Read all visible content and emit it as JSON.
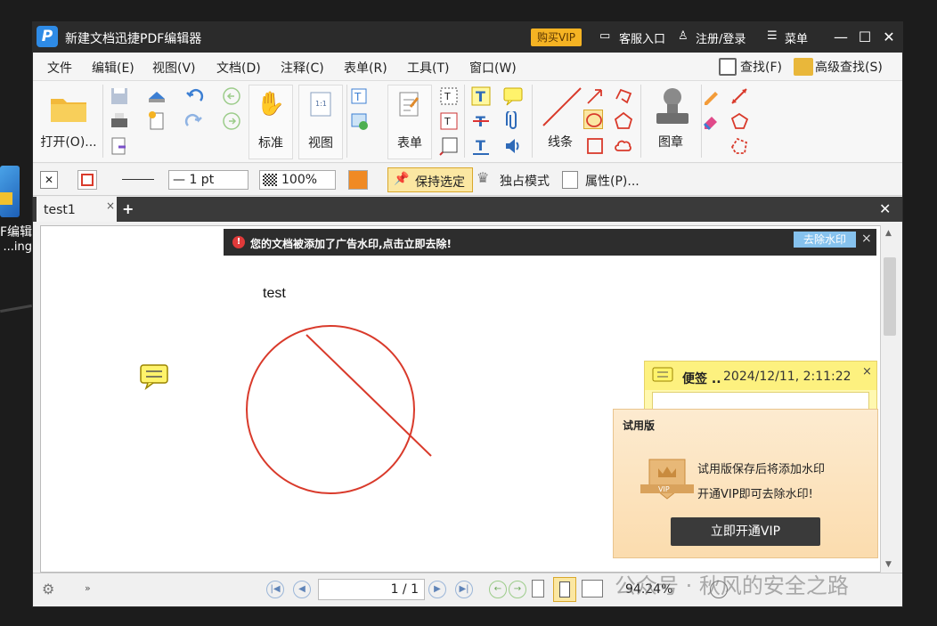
{
  "desktop": {
    "label1": "F编辑",
    "label2": "ing..."
  },
  "titlebar": {
    "logo": "P",
    "title": "新建文档迅捷PDF编辑器",
    "vip": "购买VIP",
    "service": "客服入口",
    "register": "注册/登录",
    "menu": "菜单"
  },
  "menubar": {
    "items": [
      "文件",
      "编辑(E)",
      "视图(V)",
      "文档(D)",
      "注释(C)",
      "表单(R)",
      "工具(T)",
      "窗口(W)"
    ],
    "find": "查找(F)",
    "adv_find": "高级查找(S)"
  },
  "ribbon": {
    "open": "打开(O)...",
    "standard": "标准",
    "view": "视图",
    "form": "表单",
    "line": "线条",
    "stamp": "图章"
  },
  "toolbar2": {
    "line_width": "— 1 pt",
    "opacity": "100%",
    "keep": "保持选定",
    "exclusive": "独占模式",
    "props": "属性(P)..."
  },
  "tabs": {
    "tab1": "test1",
    "close": "×",
    "add": "+"
  },
  "notice": {
    "text": "您的文档被添加了广告水印,点击立即去除!",
    "button": "去除水印",
    "close": "×"
  },
  "doc": {
    "text": "test"
  },
  "sticky": {
    "title": "便签 ..",
    "date": "2024/12/11, 2:11:22",
    "close": "×"
  },
  "trial": {
    "title": "试用版",
    "line1": "试用版保存后将添加水印",
    "line2": "开通VIP即可去除水印!",
    "button": "立即开通VIP",
    "badge": "VIP"
  },
  "status": {
    "page": "1 / 1",
    "zoom": "94.24%"
  },
  "watermark": "公众号 · 秋风的安全之路",
  "colors": {
    "accent": "#f5b323",
    "shape": "#d93a2b",
    "title_bg": "#2b2b2b"
  }
}
